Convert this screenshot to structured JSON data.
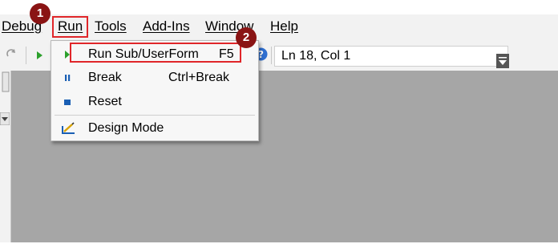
{
  "menubar": {
    "items": [
      {
        "label": "Debug"
      },
      {
        "label": "Run"
      },
      {
        "label": "Tools"
      },
      {
        "label": "Add-Ins"
      },
      {
        "label": "Window"
      },
      {
        "label": "Help"
      }
    ]
  },
  "toolbar": {
    "status": "Ln 18, Col 1"
  },
  "run_menu": {
    "items": [
      {
        "label": "Run Sub/UserForm",
        "shortcut": "F5",
        "icon": "run-triangle-icon"
      },
      {
        "label": "Break",
        "shortcut": "Ctrl+Break",
        "icon": "pause-icon"
      },
      {
        "label": "Reset",
        "shortcut": "",
        "icon": "stop-square-icon"
      },
      {
        "label": "Design Mode",
        "shortcut": "",
        "icon": "design-mode-icon"
      }
    ]
  },
  "callouts": [
    "1",
    "2"
  ],
  "colors": {
    "highlight": "#e0262a",
    "badge": "#8a1414",
    "run_green": "#2ca02c",
    "icon_blue": "#1a5fb4"
  }
}
